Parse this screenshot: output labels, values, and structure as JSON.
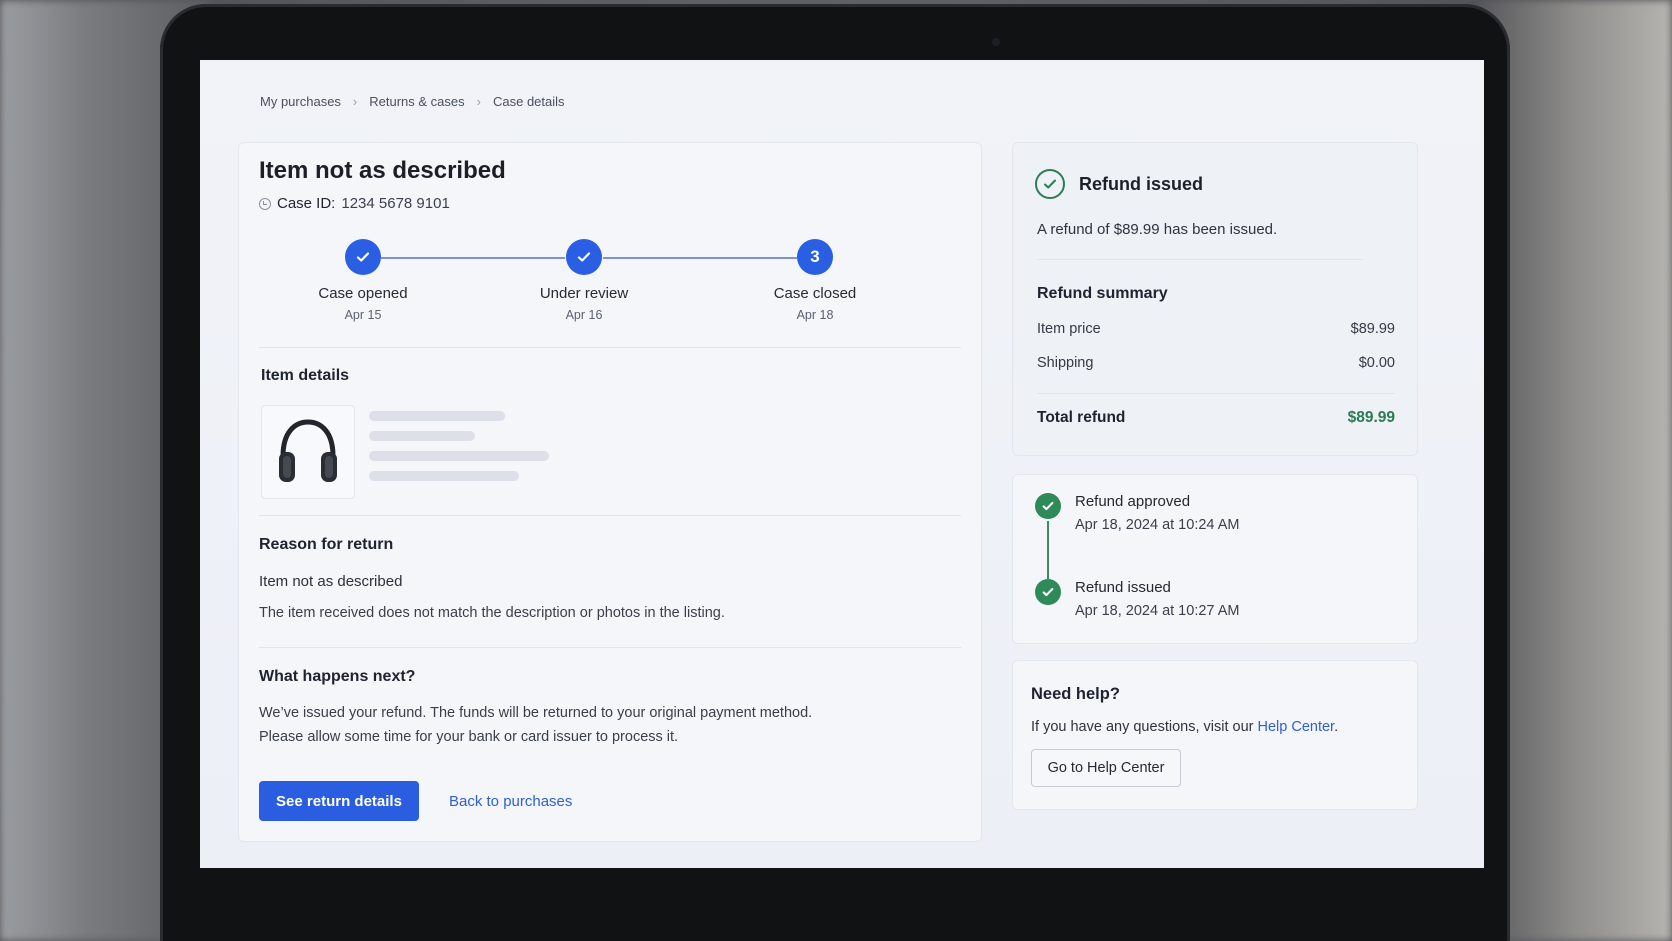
{
  "breadcrumb": {
    "items": [
      "My purchases",
      "Returns & cases",
      "Case details"
    ]
  },
  "case": {
    "title": "Item not as described",
    "case_id_label": "Case ID:",
    "case_id_value": "1234 5678 9101"
  },
  "stepper": {
    "steps": [
      {
        "label": "Case opened",
        "date": "Apr 15",
        "marker": "check"
      },
      {
        "label": "Under review",
        "date": "Apr 16",
        "marker": "check"
      },
      {
        "label": "Case closed",
        "date": "Apr 18",
        "marker": "3"
      }
    ]
  },
  "item_details": {
    "heading": "Item details",
    "image_icon": "headphones-icon"
  },
  "reason": {
    "heading": "Reason for return",
    "reason": "Item not as described",
    "description": "The item received does not match the description or photos in the listing."
  },
  "next": {
    "heading": "What happens next?",
    "line1": "We’ve issued your refund. The funds will be returned to your original payment method.",
    "line2": "Please allow some time for your bank or card issuer to process it."
  },
  "actions": {
    "primary_label": "See return details",
    "secondary_label": "Back to purchases"
  },
  "refund": {
    "status": "Refund issued",
    "message": "A refund of $89.99 has been issued.",
    "summary_title": "Refund summary",
    "item_price_label": "Item price",
    "item_price": "$89.99",
    "shipping_label": "Shipping",
    "shipping": "$0.00",
    "total_label": "Total refund",
    "total": "$89.99"
  },
  "timeline": {
    "events": [
      {
        "title": "Refund approved",
        "time": "Apr 18, 2024 at 10:24 AM"
      },
      {
        "title": "Refund issued",
        "time": "Apr 18, 2024 at 10:27 AM"
      }
    ]
  },
  "help": {
    "heading": "Need help?",
    "text_prefix": "If you have any questions, visit our ",
    "link_text": "Help Center",
    "text_suffix": ".",
    "button_label": "Go to Help Center"
  },
  "colors": {
    "accent": "#2b5de0",
    "success": "#2f8a5a",
    "total_amount": "#2b7a52",
    "link": "#2f5ed8"
  }
}
